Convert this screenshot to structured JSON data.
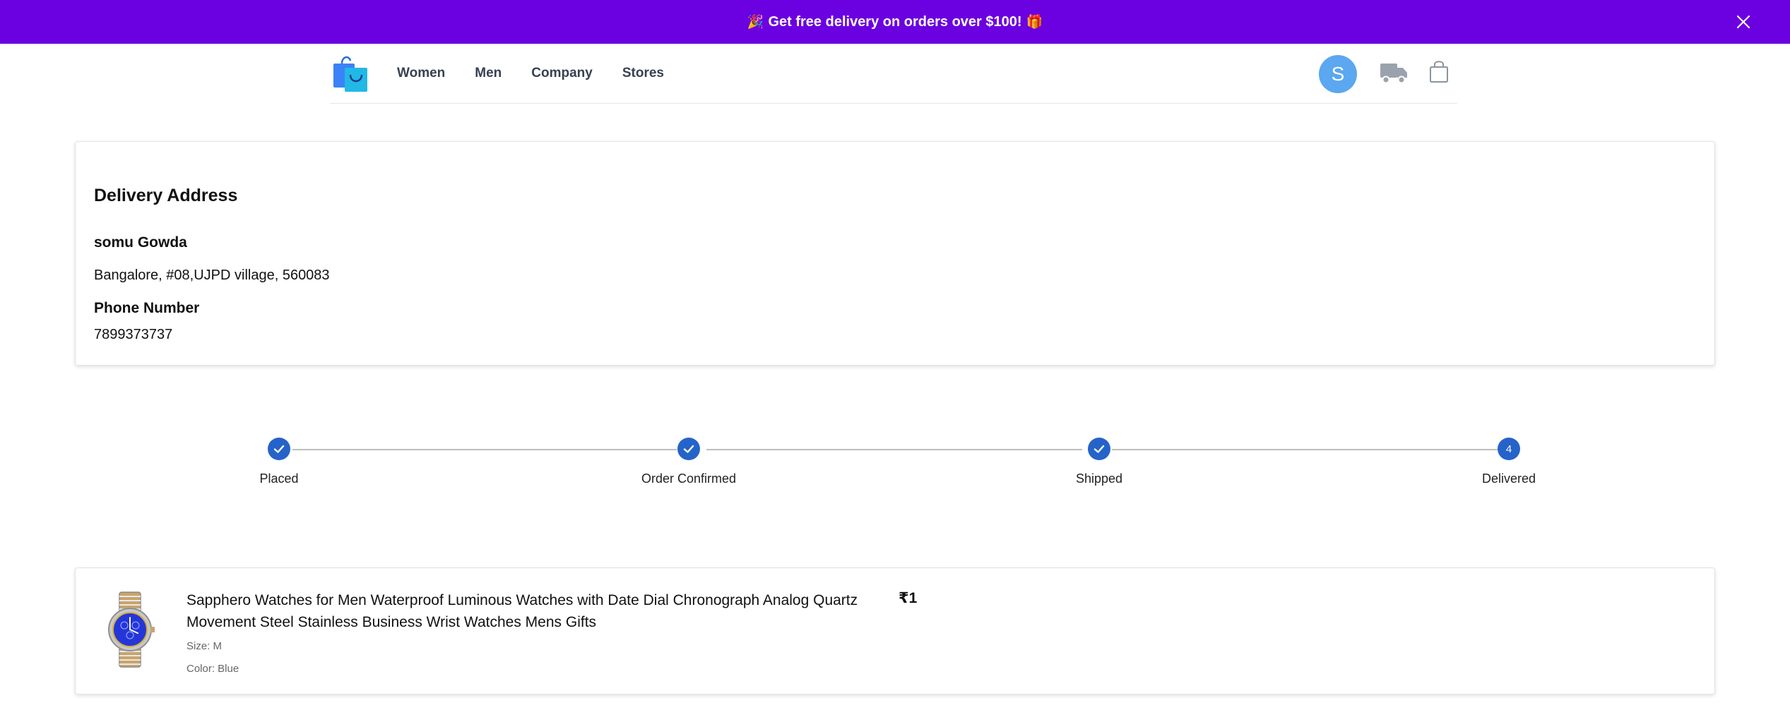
{
  "promo": {
    "emoji_left": "🎉",
    "text": "Get free delivery on orders over $100!",
    "emoji_right": "🎁"
  },
  "header": {
    "nav": [
      "Women",
      "Men",
      "Company",
      "Stores"
    ],
    "avatar_initial": "S",
    "icons": [
      "shopping-bag-logo",
      "truck-icon",
      "bag-icon"
    ]
  },
  "address": {
    "title": "Delivery Address",
    "name": "somu Gowda",
    "line": "Bangalore, #08,UJPD village, 560083",
    "phone_label": "Phone Number",
    "phone": "7899373737"
  },
  "stepper": {
    "steps": [
      {
        "label": "Placed",
        "status": "done"
      },
      {
        "label": "Order Confirmed",
        "status": "done"
      },
      {
        "label": "Shipped",
        "status": "done"
      },
      {
        "label": "Delivered",
        "status": "active",
        "number": "4"
      }
    ],
    "accent": "#2563c9"
  },
  "product": {
    "title": "Sapphero Watches for Men Waterproof Luminous Watches with Date Dial Chronograph Analog Quartz Movement Steel Stainless Business Wrist Watches Mens Gifts",
    "price": "₹1",
    "size": "Size: M",
    "color": "Color: Blue"
  },
  "colors": {
    "promo_bg": "#6b00e0",
    "avatar_bg": "#5ba7f0"
  }
}
